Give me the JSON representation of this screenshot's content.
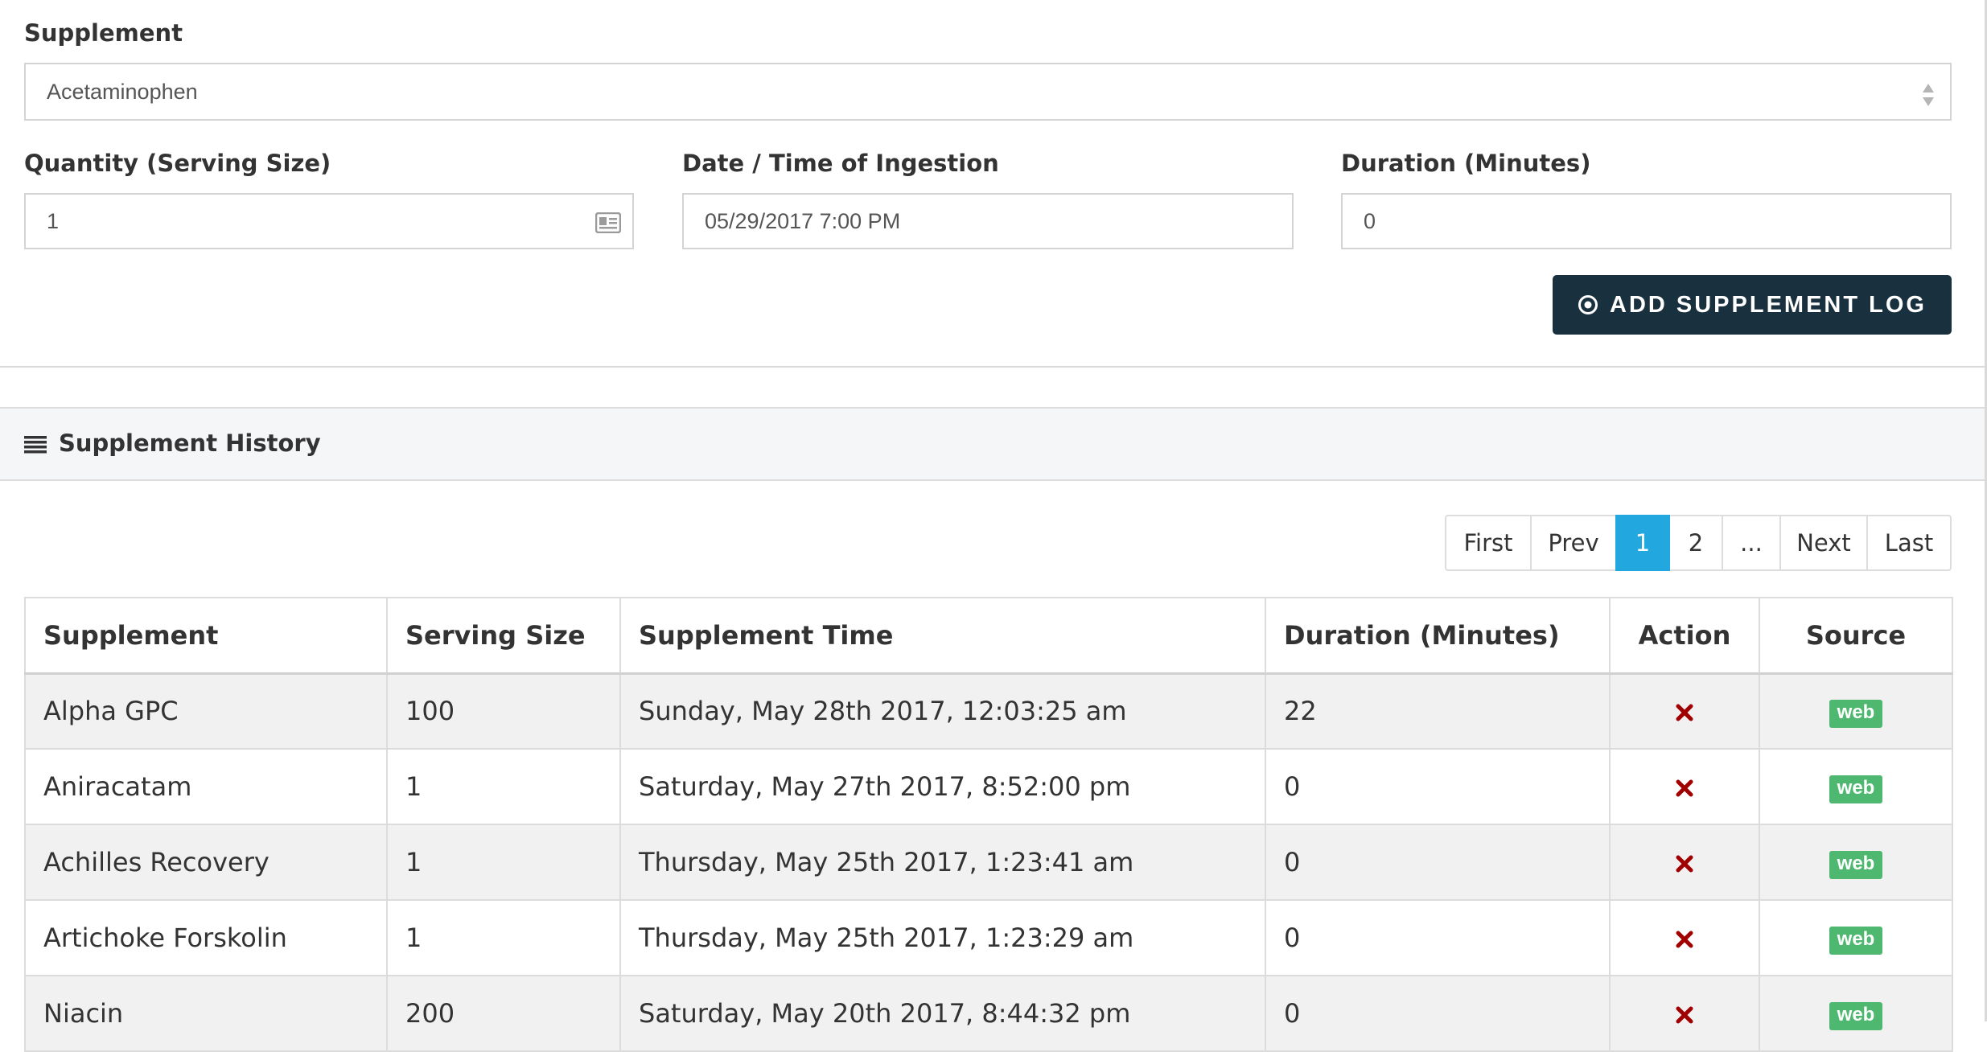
{
  "form": {
    "supplement_label": "Supplement",
    "supplement_value": "Acetaminophen",
    "quantity_label": "Quantity (Serving Size)",
    "quantity_value": "1",
    "datetime_label": "Date / Time of Ingestion",
    "datetime_value": "05/29/2017 7:00 PM",
    "duration_label": "Duration (Minutes)",
    "duration_value": "0",
    "add_button_label": "ADD SUPPLEMENT LOG"
  },
  "history": {
    "title": "Supplement History",
    "icon": "list-icon",
    "pagination": [
      "First",
      "Prev",
      "1",
      "2",
      "...",
      "Next",
      "Last"
    ],
    "active_page": "1",
    "columns": [
      "Supplement",
      "Serving Size",
      "Supplement Time",
      "Duration (Minutes)",
      "Action",
      "Source"
    ],
    "rows": [
      {
        "supplement": "Alpha GPC",
        "serving": "100",
        "time": "Sunday, May 28th 2017, 12:03:25 am",
        "duration": "22",
        "source": "web"
      },
      {
        "supplement": "Aniracatam",
        "serving": "1",
        "time": "Saturday, May 27th 2017, 8:52:00 pm",
        "duration": "0",
        "source": "web"
      },
      {
        "supplement": "Achilles Recovery",
        "serving": "1",
        "time": "Thursday, May 25th 2017, 1:23:41 am",
        "duration": "0",
        "source": "web"
      },
      {
        "supplement": "Artichoke Forskolin",
        "serving": "1",
        "time": "Thursday, May 25th 2017, 1:23:29 am",
        "duration": "0",
        "source": "web"
      },
      {
        "supplement": "Niacin",
        "serving": "200",
        "time": "Saturday, May 20th 2017, 8:44:32 pm",
        "duration": "0",
        "source": "web"
      }
    ]
  },
  "colors": {
    "button_bg": "#19303e",
    "pager_active": "#22a7de",
    "delete_icon": "#a00000",
    "source_badge": "#4eb870"
  }
}
